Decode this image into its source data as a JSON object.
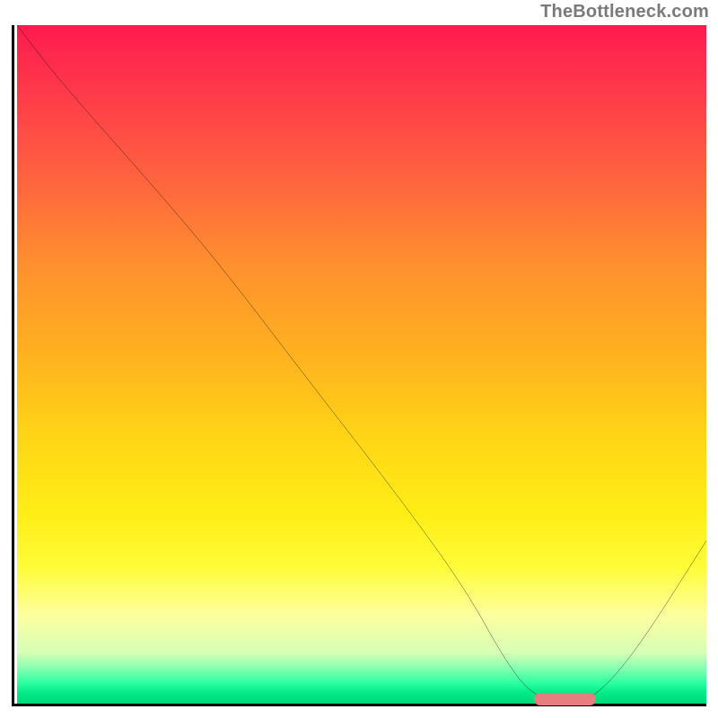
{
  "attribution": "TheBottleneck.com",
  "chart_data": {
    "type": "line",
    "title": "",
    "xlabel": "",
    "ylabel": "",
    "xlim": [
      0,
      100
    ],
    "ylim": [
      0,
      100
    ],
    "grid": false,
    "legend": false,
    "axes_visible": {
      "left": true,
      "bottom": true,
      "right": false,
      "top": false
    },
    "tick_labels": {
      "x": [],
      "y": []
    },
    "background_gradient": {
      "direction": "vertical",
      "stops": [
        {
          "pct": 0,
          "color": "#ff1a4f"
        },
        {
          "pct": 25,
          "color": "#ff6b3c"
        },
        {
          "pct": 50,
          "color": "#ffbb1c"
        },
        {
          "pct": 72,
          "color": "#ffee15"
        },
        {
          "pct": 88,
          "color": "#fbffb0"
        },
        {
          "pct": 96,
          "color": "#70ffad"
        },
        {
          "pct": 100,
          "color": "#00d978"
        }
      ]
    },
    "series": [
      {
        "name": "bottleneck-curve",
        "color": "#000000",
        "x": [
          0,
          6,
          20,
          30,
          42,
          55,
          65,
          71,
          75,
          80,
          84,
          90,
          100
        ],
        "y": [
          100,
          92,
          76,
          64,
          48,
          31,
          17,
          6,
          1,
          0,
          1,
          8,
          24
        ]
      }
    ],
    "markers": [
      {
        "name": "optimal-range",
        "shape": "rounded-bar",
        "color": "#e67d7f",
        "x_start": 75,
        "x_end": 84,
        "y": 0.6
      }
    ]
  }
}
